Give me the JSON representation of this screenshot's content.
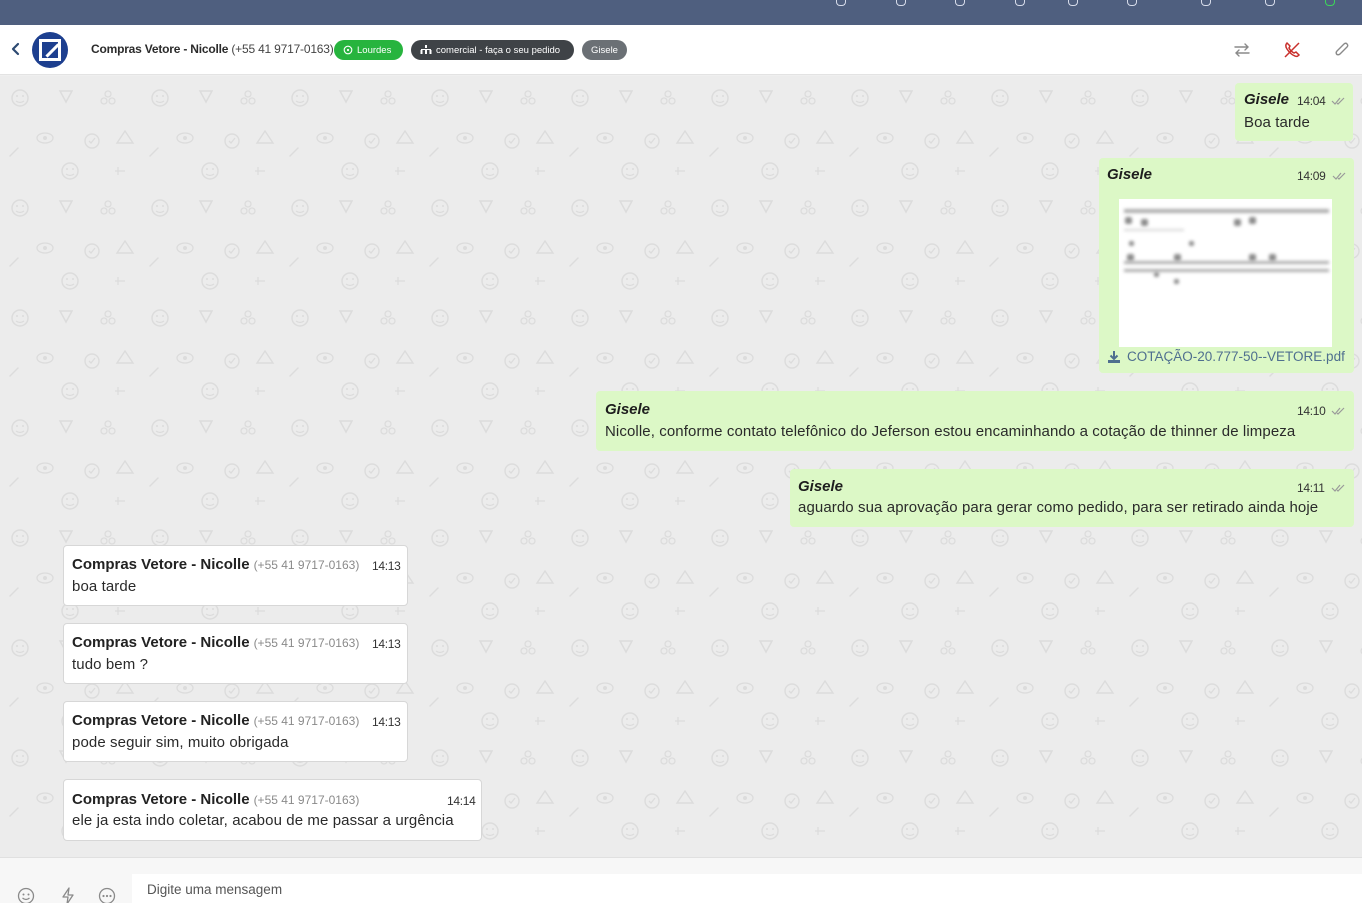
{
  "topbar": {
    "icons": [
      "chat-icon",
      "note-icon",
      "check-icon",
      "clipboard-icon",
      "contacts-icon",
      "help-icon",
      "pin-icon",
      "status-icon",
      "online-icon"
    ]
  },
  "header": {
    "contact_name": "Compras Vetore - Nicolle",
    "contact_phone": "(+55 41 9717-0163)",
    "tags": {
      "channel": "Lourdes",
      "queue": "comercial - faça o seu pedido",
      "agent": "Gisele"
    },
    "actions": [
      "transfer-icon",
      "end-call-icon",
      "attach-icon"
    ]
  },
  "messages": {
    "m1": {
      "sender": "Gisele",
      "time": "14:04",
      "text": "Boa tarde"
    },
    "m2": {
      "sender": "Gisele",
      "time": "14:09",
      "file_name": "COTAÇÃO-20.777-50--VETORE.pdf"
    },
    "m3": {
      "sender": "Gisele",
      "time": "14:10",
      "text": "Nicolle, conforme contato telefônico do Jeferson estou encaminhando a cotação de thinner de limpeza"
    },
    "m4": {
      "sender": "Gisele",
      "time": "14:11",
      "text": "aguardo sua aprovação para gerar como pedido, para ser retirado ainda hoje"
    },
    "m5": {
      "sender": "Compras Vetore - Nicolle",
      "phone": "(+55 41 9717-0163)",
      "time": "14:13",
      "text": "boa tarde"
    },
    "m6": {
      "sender": "Compras Vetore - Nicolle",
      "phone": "(+55 41 9717-0163)",
      "time": "14:13",
      "text": "tudo bem ?"
    },
    "m7": {
      "sender": "Compras Vetore - Nicolle",
      "phone": "(+55 41 9717-0163)",
      "time": "14:13",
      "text": "pode seguir sim, muito obrigada"
    },
    "m8": {
      "sender": "Compras Vetore - Nicolle",
      "phone": "(+55 41 9717-0163)",
      "time": "14:14",
      "text": "ele ja esta indo coletar, acabou de me passar a urgência"
    }
  },
  "composer": {
    "placeholder": "Digite uma mensagem",
    "tools": [
      "emoji-icon",
      "quick-reply-icon",
      "more-icon"
    ]
  },
  "colors": {
    "topbar": "#4f5f7f",
    "outgoing_bubble": "#dcf8c6",
    "incoming_bubble": "#ffffff",
    "whatsapp_tag": "#27b43e",
    "queue_tag": "#3f4347",
    "agent_tag": "#6b7075",
    "end_call": "#c9302c"
  }
}
